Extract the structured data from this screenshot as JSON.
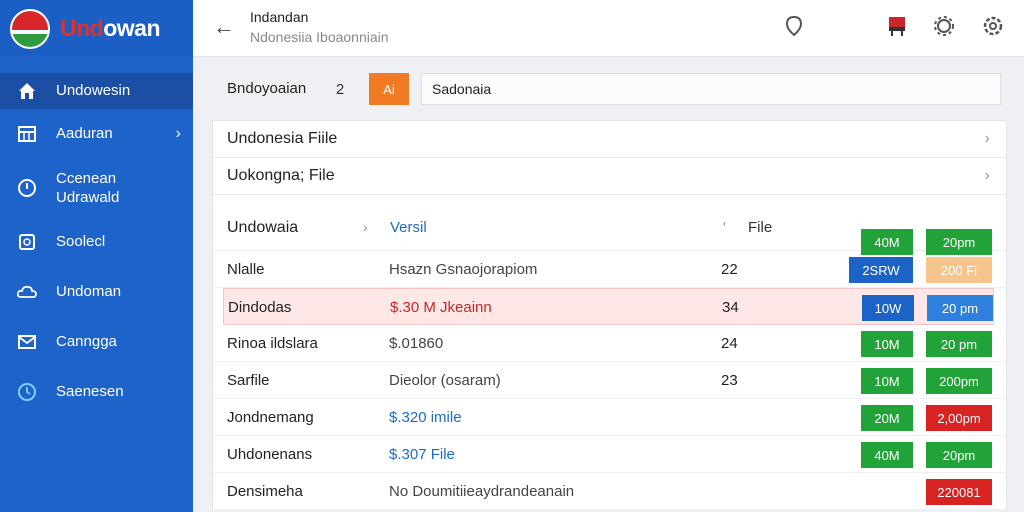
{
  "brand": {
    "name_red": "Und",
    "name_white": "owan",
    "logo_icon": "flag-circle-logo"
  },
  "sidebar": {
    "items": [
      {
        "label": "Undowesin",
        "icon": "home-icon",
        "active": true
      },
      {
        "label": "Aaduran",
        "icon": "grid-icon",
        "chevron": true
      },
      {
        "label": "Ccenean\nUdrawald",
        "icon": "info-icon"
      },
      {
        "label": "Soolecl",
        "icon": "square-icon"
      },
      {
        "label": "Undoman",
        "icon": "cloud-icon"
      },
      {
        "label": "Canngga",
        "icon": "mail-icon"
      },
      {
        "label": "Saenesen",
        "icon": "clock-icon"
      }
    ]
  },
  "topbar": {
    "title": "Indandan",
    "subtitle": "Ndonesiia Iboaonniain",
    "icons": [
      "location-icon",
      "flag-icon",
      "gear-icon",
      "settings-icon"
    ]
  },
  "filter": {
    "label": "Bndoyoaian",
    "number": "2",
    "button_label": "Ai",
    "input_value": "Sadonaia"
  },
  "files": [
    {
      "label": "Undonesia Fiile"
    },
    {
      "label": "Uokongna; File"
    }
  ],
  "table": {
    "header": {
      "name": "Undowaia",
      "version": "Versil",
      "file": "File",
      "badge1": "40M",
      "badge2": "20pm"
    },
    "rows": [
      {
        "name": "Nlalle",
        "desc": "Hsazn Gsnaojorapiom",
        "num": "22",
        "badge1": "2SRW",
        "badge1_color": "blue",
        "badge2": "200 Fi",
        "badge2_color": "orange"
      },
      {
        "name": "Dindodas",
        "desc": "$.30 M Jkeainn",
        "num": "34",
        "badge1": "10W",
        "badge1_color": "blue",
        "badge2": "20 pm",
        "badge2_color": "lblue",
        "highlight": true
      },
      {
        "name": "Rinoa ildslara",
        "desc": "$.01860",
        "num": "24",
        "badge1": "10M",
        "badge1_color": "green",
        "badge2": "20 pm",
        "badge2_color": "green"
      },
      {
        "name": "Sarfile",
        "desc": "Dieolor (osaram)",
        "num": "23",
        "badge1": "10M",
        "badge1_color": "green",
        "badge2": "200pm",
        "badge2_color": "green"
      },
      {
        "name": "Jondnemang",
        "desc": "$.320 imile",
        "num": "",
        "badge1": "20M",
        "badge1_color": "green",
        "badge2": "2,00pm",
        "badge2_color": "red"
      },
      {
        "name": "Uhdonenans",
        "desc": "$.307 File",
        "num": "",
        "badge1": "40M",
        "badge1_color": "green",
        "badge2": "20pm",
        "badge2_color": "green"
      },
      {
        "name": "Densimeha",
        "desc": "No Doumitiieaydrandeanain",
        "num": "",
        "badge1": "",
        "badge1_color": "",
        "badge2": "220081",
        "badge2_color": "red"
      }
    ]
  },
  "colors": {
    "sidebar": "#1e63c9",
    "accent_orange": "#f07b22",
    "green": "#22a33a",
    "blue": "#1b63c6",
    "red": "#d82323"
  }
}
